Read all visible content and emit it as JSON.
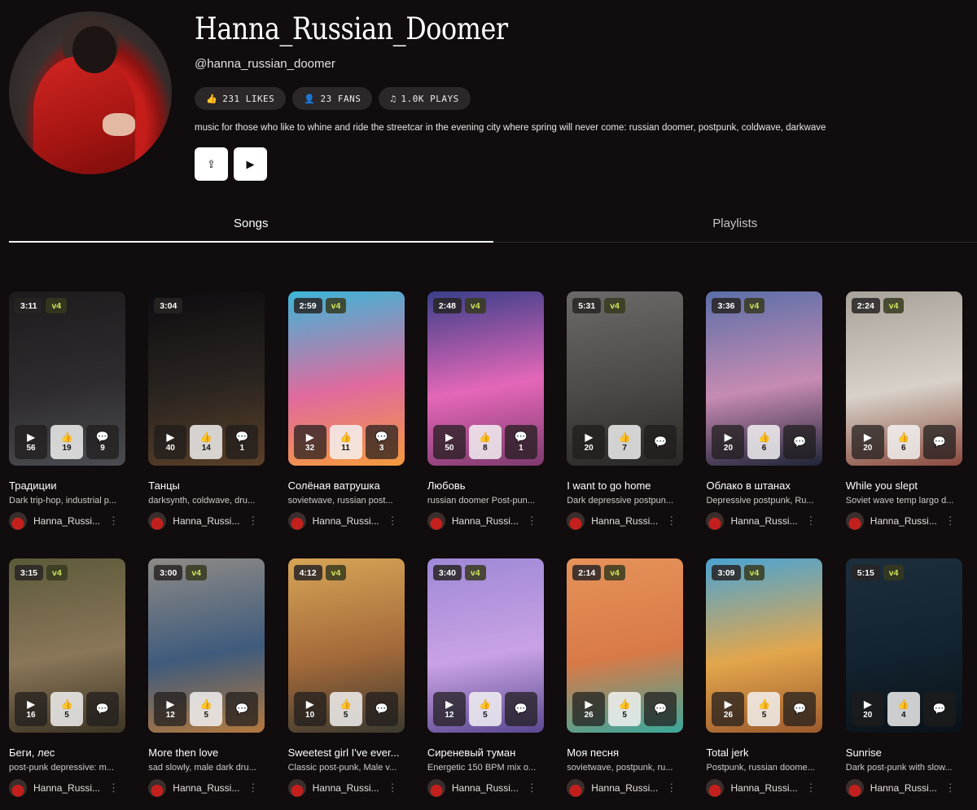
{
  "profile": {
    "name": "Hanna_Russian_Doomer",
    "handle": "@hanna_russian_doomer",
    "stats": [
      {
        "icon": "thumbs-up-icon",
        "label": "231 LIKES"
      },
      {
        "icon": "user-icon",
        "label": "23 FANS"
      },
      {
        "icon": "music-note-icon",
        "label": "1.0K PLAYS"
      }
    ],
    "bio": "music for those who like to whine and ride the streetcar in the evening city where spring will never come: russian doomer, postpunk, coldwave, darkwave",
    "actions": {
      "share_icon": "share-icon",
      "play_icon": "play-icon"
    }
  },
  "tabs": [
    {
      "label": "Songs",
      "active": true
    },
    {
      "label": "Playlists",
      "active": false
    }
  ],
  "author_name": "Hanna_Russi...",
  "badge_version": "v4",
  "songs": [
    {
      "duration": "3:11",
      "plays": "56",
      "likes": "19",
      "comments": "9",
      "title": "Традиции",
      "desc": "Dark trip-hop, industrial p...",
      "colors": [
        "#1d1b1c",
        "#2e2c2e",
        "#4b4c52"
      ]
    },
    {
      "duration": "3:04",
      "plays": "40",
      "likes": "14",
      "comments": "1",
      "title": "Танцы",
      "desc": "darksynth, coldwave, dru...",
      "colors": [
        "#0d0c10",
        "#2b2520",
        "#5a4028"
      ]
    },
    {
      "duration": "2:59",
      "plays": "32",
      "likes": "11",
      "comments": "3",
      "title": "Солёная ватрушка",
      "desc": "sovietwave, russian post...",
      "colors": [
        "#3cb6d8",
        "#e06a9e",
        "#f59a3c"
      ]
    },
    {
      "duration": "2:48",
      "plays": "50",
      "likes": "8",
      "comments": "1",
      "title": "Любовь",
      "desc": "russian doomer Post-pun...",
      "colors": [
        "#3a3f8a",
        "#e467b8",
        "#7d3a6e"
      ]
    },
    {
      "duration": "5:31",
      "plays": "20",
      "likes": "7",
      "comments": "",
      "title": "I want to go home",
      "desc": "Dark depressive postpun...",
      "colors": [
        "#6c6a68",
        "#4b4846",
        "#2a2826"
      ]
    },
    {
      "duration": "3:36",
      "plays": "20",
      "likes": "6",
      "comments": "",
      "title": "Облако в штанах",
      "desc": "Depressive postpunk, Ru...",
      "colors": [
        "#5b6fa8",
        "#c78bb2",
        "#1f2438"
      ]
    },
    {
      "duration": "2:24",
      "plays": "20",
      "likes": "6",
      "comments": "",
      "title": "While you slept",
      "desc": "Soviet wave temp largo d...",
      "colors": [
        "#a8a29a",
        "#d7d1c8",
        "#8b4a3e"
      ]
    },
    {
      "duration": "3:15",
      "plays": "16",
      "likes": "5",
      "comments": "",
      "title": "Беги, лес",
      "desc": "post-punk depressive: m...",
      "colors": [
        "#5c5a3a",
        "#8a7658",
        "#3c3424"
      ]
    },
    {
      "duration": "3:00",
      "plays": "12",
      "likes": "5",
      "comments": "",
      "title": "More then love",
      "desc": "sad slowly, male dark dru...",
      "colors": [
        "#8e8a86",
        "#3f5b7c",
        "#b3793e"
      ]
    },
    {
      "duration": "4:12",
      "plays": "10",
      "likes": "5",
      "comments": "",
      "title": "Sweetest girl I've ever...",
      "desc": "Classic post-punk, Male v...",
      "colors": [
        "#d6a456",
        "#a46a3a",
        "#3c3a30"
      ]
    },
    {
      "duration": "3:40",
      "plays": "12",
      "likes": "5",
      "comments": "",
      "title": "Сиреневый туман",
      "desc": "Energetic 150 BPM mix o...",
      "colors": [
        "#9e88d6",
        "#c9a2e4",
        "#5a4890"
      ]
    },
    {
      "duration": "2:14",
      "plays": "26",
      "likes": "5",
      "comments": "",
      "title": "Моя песня",
      "desc": "sovietwave, postpunk, ru...",
      "colors": [
        "#e6925a",
        "#d87a48",
        "#3aa89c"
      ]
    },
    {
      "duration": "3:09",
      "plays": "26",
      "likes": "5",
      "comments": "",
      "title": "Total jerk",
      "desc": "Postpunk, russian doome...",
      "colors": [
        "#4aa4d4",
        "#e2a64c",
        "#9c5a2c"
      ]
    },
    {
      "duration": "5:15",
      "plays": "20",
      "likes": "4",
      "comments": "",
      "title": "Sunrise",
      "desc": "Dark post-punk with slow...",
      "colors": [
        "#1d2e3c",
        "#12222e",
        "#0a1218"
      ]
    }
  ]
}
